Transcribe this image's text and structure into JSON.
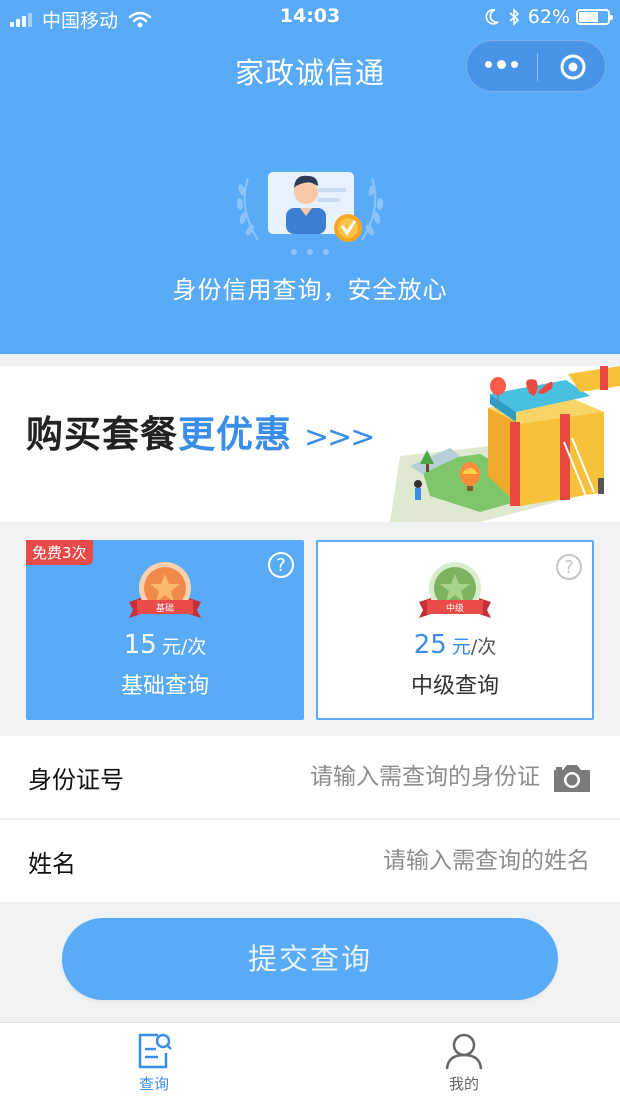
{
  "status_bar": {
    "carrier": "中国移动",
    "time": "14:03",
    "battery": "62%",
    "icons": [
      "signal-icon",
      "wifi-icon",
      "moon-icon",
      "bluetooth-icon",
      "battery-icon"
    ]
  },
  "header": {
    "title": "家政诚信通",
    "hero_text": "身份信用查询，安全放心",
    "capsule_icons": [
      "more-icon",
      "close-target-icon"
    ]
  },
  "banner": {
    "text_dark": "购买套餐",
    "text_blue": "更优惠",
    "arrows": ">>>"
  },
  "packages": [
    {
      "tag": "免费3次",
      "ribbon": "基础",
      "price": "15",
      "unit": "元",
      "per": "/次",
      "name": "基础查询",
      "selected": true
    },
    {
      "ribbon": "中级",
      "price": "25",
      "unit": "元",
      "per": "/次",
      "name": "中级查询",
      "selected": false
    }
  ],
  "help_symbol": "?",
  "form": {
    "id_label": "身份证号",
    "id_placeholder": "请输入需查询的身份证",
    "name_label": "姓名",
    "name_placeholder": "请输入需查询的姓名"
  },
  "submit_label": "提交查询",
  "tabbar": {
    "items": [
      {
        "label": "查询",
        "icon": "query-doc-icon",
        "active": true
      },
      {
        "label": "我的",
        "icon": "user-icon",
        "active": false
      }
    ]
  },
  "colors": {
    "primary": "#5aabf7",
    "accent_text": "#3a8de8",
    "free_tag": "#e84a4a"
  }
}
